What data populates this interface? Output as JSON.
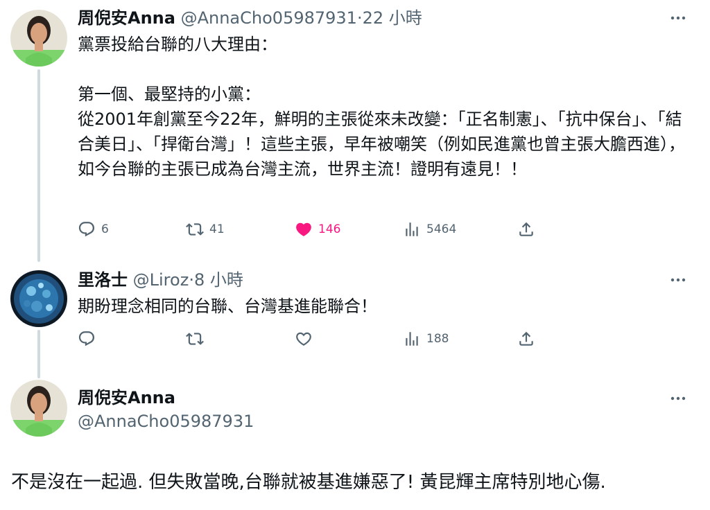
{
  "tweet1": {
    "author_name": "周倪安Anna",
    "handle": "@AnnaCho05987931",
    "separator": "·",
    "time": "22 小時",
    "paragraphs": [
      "黨票投給台聯的八大理由：",
      "第一個、最堅持的小黨：\n從2001年創黨至今22年，鮮明的主張從來未改變：「正名制憲」、「抗中保台」、「結合美日」、「捍衛台灣」！這些主張，早年被嘲笑（例如民進黨也曾主張大膽西進），如今台聯的主張已成為台灣主流，世界主流！證明有遠見！！"
    ],
    "replies": "6",
    "retweets": "41",
    "likes": "146",
    "views": "5464",
    "liked": true
  },
  "tweet2": {
    "author_name": "里洛士",
    "handle": "@Liroz",
    "separator": "·",
    "time": "8 小時",
    "text": "期盼理念相同的台聯、台灣基進能聯合！",
    "replies": "",
    "retweets": "",
    "likes": "",
    "views": "188"
  },
  "tweet3": {
    "author_name": "周倪安Anna",
    "handle": "@AnnaCho05987931",
    "text": "不是沒在一起過. 但失敗當晚,台聯就被基進嫌惡了! 黃昆輝主席特別地心傷."
  },
  "icons": {
    "reply": "reply-icon",
    "retweet": "retweet-icon",
    "like": "heart-icon",
    "views": "views-icon",
    "share": "share-icon",
    "more": "more-icon"
  },
  "colors": {
    "like_active": "#f91880",
    "secondary_text": "#536471",
    "thread_line": "#cfd9de"
  }
}
